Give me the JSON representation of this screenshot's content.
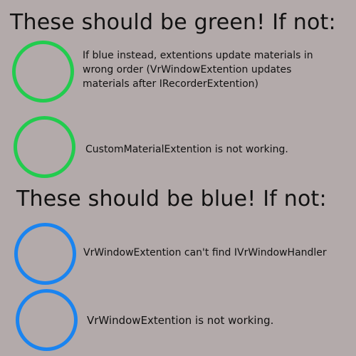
{
  "colors": {
    "background": "#b3aaaa",
    "green_ring": "#22cc4e",
    "blue_ring": "#1a84f0",
    "text": "#111111"
  },
  "green_section": {
    "heading": "These should be green! If not:",
    "items": [
      {
        "lines": [
          "If blue instead, extentions update materials in",
          "wrong order (VrWindowExtention updates",
          "materials after IRecorderExtention)"
        ]
      },
      {
        "lines": [
          "CustomMaterialExtention is not working."
        ]
      }
    ]
  },
  "blue_section": {
    "heading": "These should be blue! If not:",
    "items": [
      {
        "lines": [
          "VrWindowExtention can't find IVrWindowHandler"
        ]
      },
      {
        "lines": [
          "VrWindowExtention is not working."
        ]
      }
    ]
  }
}
